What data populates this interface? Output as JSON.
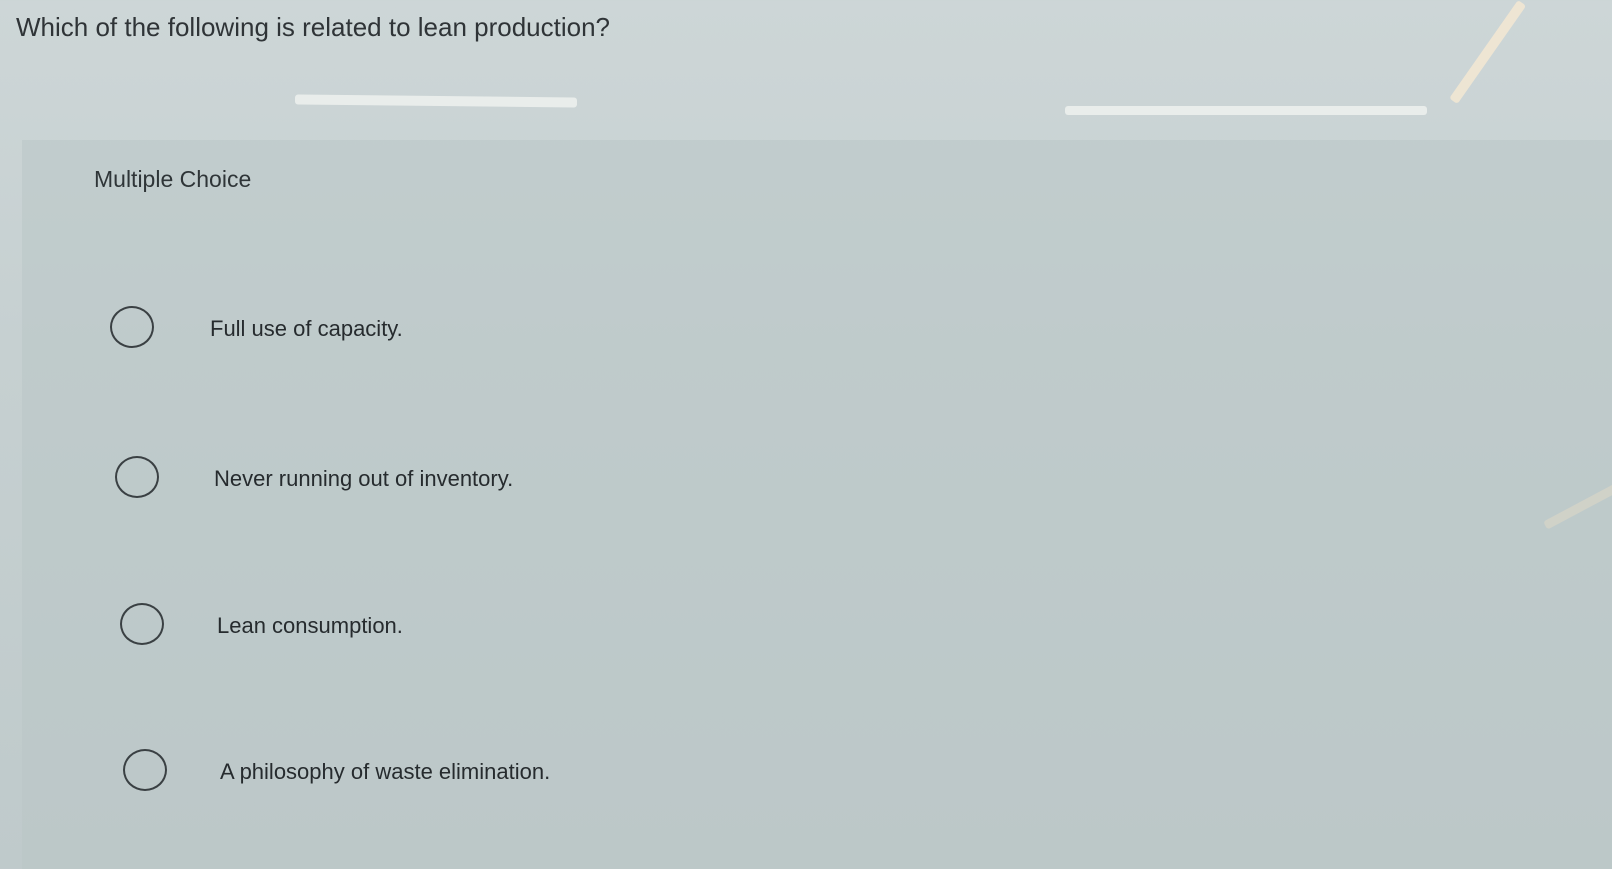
{
  "question": {
    "text": "Which of the following is related to lean production?"
  },
  "section": {
    "label": "Multiple Choice"
  },
  "choices": [
    {
      "label": "Full use of capacity.",
      "selected": false
    },
    {
      "label": "Never running out of inventory.",
      "selected": false
    },
    {
      "label": "Lean consumption.",
      "selected": false
    },
    {
      "label": "A philosophy of waste elimination.",
      "selected": false
    }
  ]
}
